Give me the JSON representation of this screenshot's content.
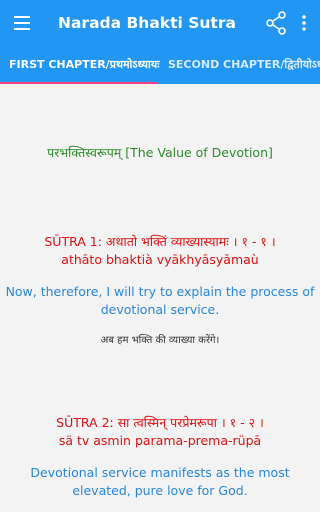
{
  "appbar": {
    "title": "Narada Bhakti Sutra",
    "icons": [
      "menu-icon",
      "share-icon",
      "more-vert-icon"
    ]
  },
  "tabs": [
    {
      "label": "FIRST CHAPTER/प्रथमोऽध्यायः",
      "selected": true
    },
    {
      "label": "SECOND CHAPTER/द्वितीयोऽध्यायः",
      "selected": false
    }
  ],
  "content": {
    "heading": "परभक्तिस्वरूपम् [The Value of Devotion]",
    "sutras": [
      {
        "title": "SŪTRA 1: अथातो भक्तिं व्याख्यास्यामः । १ - १ ।",
        "transliteration": "athāto bhaktià vyākhyāsyāmaù",
        "english_line1": "Now, therefore, I will try to explain the process of",
        "english_line2": "devotional service.",
        "hindi": "अब हम भक्ति की व्याख्या करेंगे।"
      },
      {
        "title": "SŪTRA 2: सा त्वस्मिन् परप्रेमरूपा । १ - २ ।",
        "transliteration": "sä tv asmin parama-prema-rüpā",
        "english_line1": "Devotional service manifests as the most",
        "english_line2": "elevated, pure love for God."
      }
    ]
  },
  "colors": {
    "primary": "#2196f3",
    "accent": "#ff4081",
    "heading_green": "#2e8b2e",
    "sutra_red": "#e01010",
    "english_blue": "#2a86d8"
  }
}
